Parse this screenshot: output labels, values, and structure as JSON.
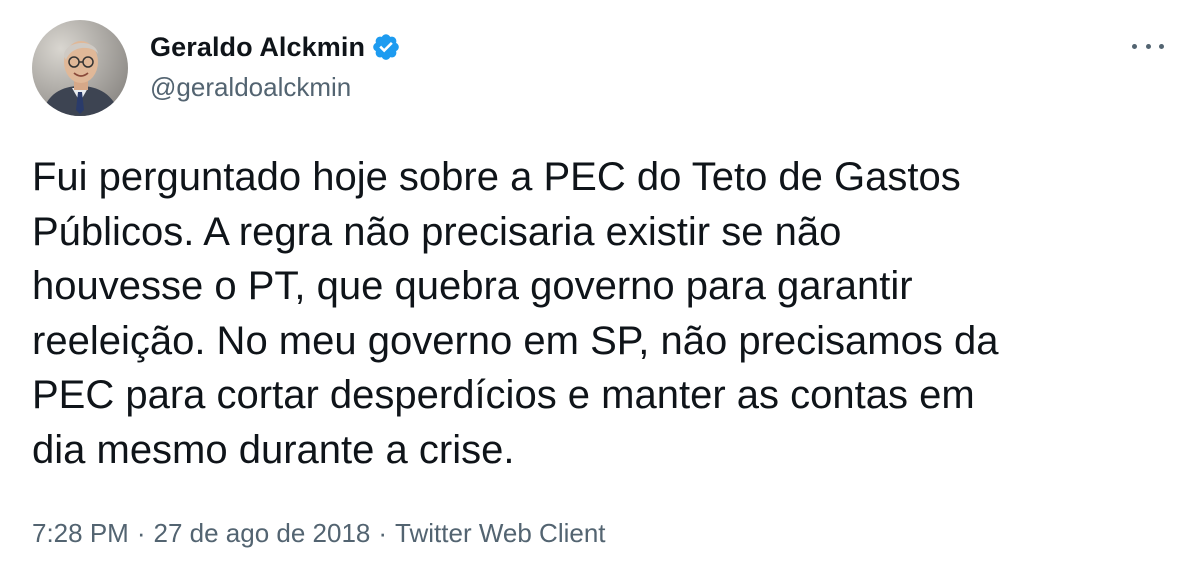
{
  "author": {
    "display_name": "Geraldo Alckmin",
    "handle": "@geraldoalckmin",
    "verified": true,
    "avatar_icon": "profile-photo"
  },
  "tweet": {
    "text": "Fui perguntado hoje sobre a PEC do Teto de Gastos\nPúblicos. A regra não precisaria existir se não\nhouvesse o PT, que quebra governo para garantir\nreeleição. No meu governo em SP, não precisamos da\nPEC para cortar desperdícios e manter as contas em\ndia mesmo durante a crise."
  },
  "meta": {
    "time": "7:28 PM",
    "separator": "·",
    "date": "27 de ago de 2018",
    "source": "Twitter Web Client"
  },
  "icons": {
    "more": "more-options-icon",
    "verified": "verified-badge-icon"
  },
  "colors": {
    "text_primary": "#0f1419",
    "text_secondary": "#536471",
    "verified_blue": "#1d9bf0",
    "background": "#ffffff"
  }
}
